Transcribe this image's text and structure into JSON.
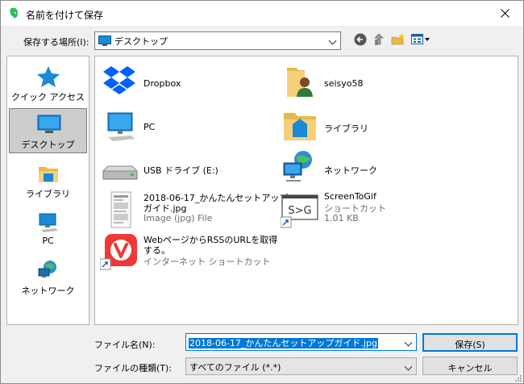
{
  "dialog": {
    "title": "名前を付けて保存"
  },
  "location": {
    "label": "保存する場所(I):",
    "value": "デスクトップ"
  },
  "toolbar": {
    "back_icon": "back-arrow-icon",
    "up_icon": "up-folder-icon",
    "new_folder_icon": "new-folder-icon",
    "view_icon": "view-menu-icon"
  },
  "places": [
    {
      "label": "クイック アクセス",
      "icon": "star-icon"
    },
    {
      "label": "デスクトップ",
      "icon": "desktop-icon",
      "selected": true
    },
    {
      "label": "ライブラリ",
      "icon": "library-icon"
    },
    {
      "label": "PC",
      "icon": "pc-icon"
    },
    {
      "label": "ネットワーク",
      "icon": "network-icon"
    }
  ],
  "files": [
    {
      "name": "Dropbox",
      "icon": "dropbox-icon"
    },
    {
      "name": "seisyo58",
      "icon": "user-folder-icon"
    },
    {
      "name": "PC",
      "icon": "pc-icon"
    },
    {
      "name": "ライブラリ",
      "icon": "library-icon"
    },
    {
      "name": "USB ドライブ (E:)",
      "icon": "usb-drive-icon"
    },
    {
      "name": "ネットワーク",
      "icon": "network-icon"
    },
    {
      "name_line1": "2018-06-17_かんたんセットアップ",
      "name_line2": "ガイド.jpg",
      "detail": "Image (jpg) File",
      "icon": "image-file-icon"
    },
    {
      "name": "ScreenToGif",
      "detail1": "ショートカット",
      "detail2": "1.01 KB",
      "icon": "screentogif-shortcut-icon"
    },
    {
      "name_line1": "WebページからRSSのURLを取得",
      "name_line2": "する。",
      "detail": "インターネット ショートカット",
      "icon": "vivaldi-shortcut-icon"
    }
  ],
  "filename": {
    "label": "ファイル名(N):",
    "value": "2018-06-17_かんたんセットアップガイド.jpg"
  },
  "filetype": {
    "label": "ファイルの種類(T):",
    "value": "すべてのファイル (*.*)"
  },
  "buttons": {
    "save": "保存(S)",
    "cancel": "キャンセル"
  }
}
